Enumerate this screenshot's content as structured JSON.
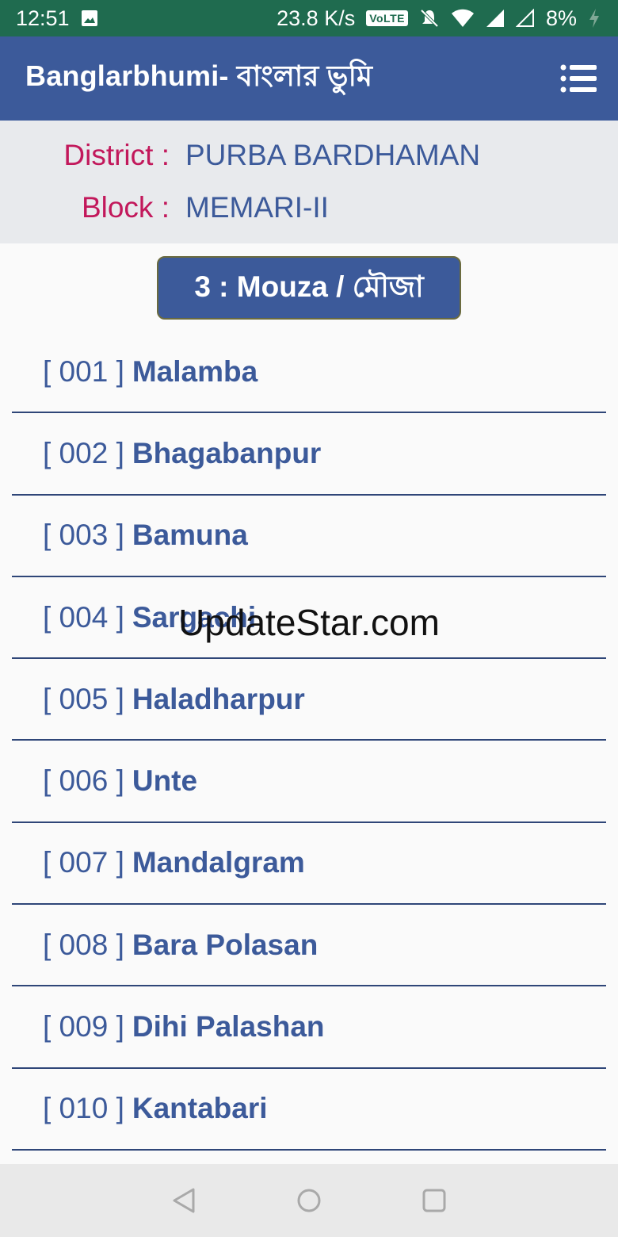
{
  "status_bar": {
    "time": "12:51",
    "net_speed": "23.8 K/s",
    "volte_label": "VoLTE",
    "battery": "8%",
    "icons": [
      "image-icon",
      "mute-icon",
      "wifi-icon",
      "signal-icon",
      "signal-empty-icon",
      "charging-icon"
    ]
  },
  "app_bar": {
    "title": "Banglarbhumi- বাংলার ভুমি",
    "menu_icon": "list-menu-icon"
  },
  "info": {
    "district_label": "District :",
    "district_value": "PURBA BARDHAMAN",
    "block_label": "Block :",
    "block_value": "MEMARI-II"
  },
  "section_button": {
    "label": "3 : Mouza / মৌজা"
  },
  "mouza_list": [
    {
      "code": "[ 001 ]",
      "name": "Malamba"
    },
    {
      "code": "[ 002 ]",
      "name": "Bhagabanpur"
    },
    {
      "code": "[ 003 ]",
      "name": "Bamuna"
    },
    {
      "code": "[ 004 ]",
      "name": "Sargachi"
    },
    {
      "code": "[ 005 ]",
      "name": "Haladharpur"
    },
    {
      "code": "[ 006 ]",
      "name": "Unte"
    },
    {
      "code": "[ 007 ]",
      "name": "Mandalgram"
    },
    {
      "code": "[ 008 ]",
      "name": "Bara Polasan"
    },
    {
      "code": "[ 009 ]",
      "name": "Dihi Palashan"
    },
    {
      "code": "[ 010 ]",
      "name": "Kantabari"
    }
  ],
  "watermark": "UpdateStar.com",
  "nav_bar": {
    "icons": [
      "back-icon",
      "home-icon",
      "recents-icon"
    ]
  },
  "colors": {
    "status_bar": "#1f6b4f",
    "app_bar": "#3c5a9a",
    "label_pink": "#c2185b",
    "divider": "#2f4678"
  }
}
